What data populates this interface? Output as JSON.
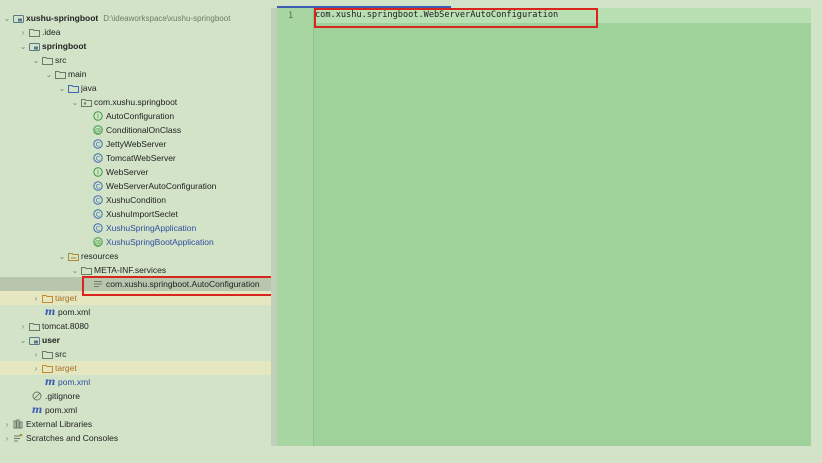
{
  "project_tree": {
    "root": {
      "label": "xushu-springboot",
      "path": "D:\\ideaworkspace\\xushu-springboot"
    },
    "items": [
      {
        "label": ".idea"
      },
      {
        "label": "springboot"
      },
      {
        "label": "src"
      },
      {
        "label": "main"
      },
      {
        "label": "java"
      },
      {
        "label": "com.xushu.springboot"
      },
      {
        "label": "AutoConfiguration"
      },
      {
        "label": "ConditionalOnClass"
      },
      {
        "label": "JettyWebServer"
      },
      {
        "label": "TomcatWebServer"
      },
      {
        "label": "WebServer"
      },
      {
        "label": "WebServerAutoConfiguration"
      },
      {
        "label": "XushuCondition"
      },
      {
        "label": "XushuImportSeclet"
      },
      {
        "label": "XushuSpringApplication"
      },
      {
        "label": "XushuSpringBootApplication"
      },
      {
        "label": "resources"
      },
      {
        "label": "META-INF.services"
      },
      {
        "label": "com.xushu.springboot.AutoConfiguration"
      },
      {
        "label": "target"
      },
      {
        "label": "pom.xml"
      },
      {
        "label": "tomcat.8080"
      },
      {
        "label": "user"
      },
      {
        "label": "src"
      },
      {
        "label": "target"
      },
      {
        "label": "pom.xml"
      },
      {
        "label": ".gitignore"
      },
      {
        "label": "pom.xml"
      },
      {
        "label": "External Libraries"
      },
      {
        "label": "Scratches and Consoles"
      }
    ]
  },
  "editor": {
    "line_number": "1",
    "code": "com.xushu.springboot.WebServerAutoConfiguration"
  },
  "colors": {
    "highlight_box": "#d9251d",
    "editor_background": "#9fd29a",
    "sidebar_background": "#d2e3c8"
  }
}
